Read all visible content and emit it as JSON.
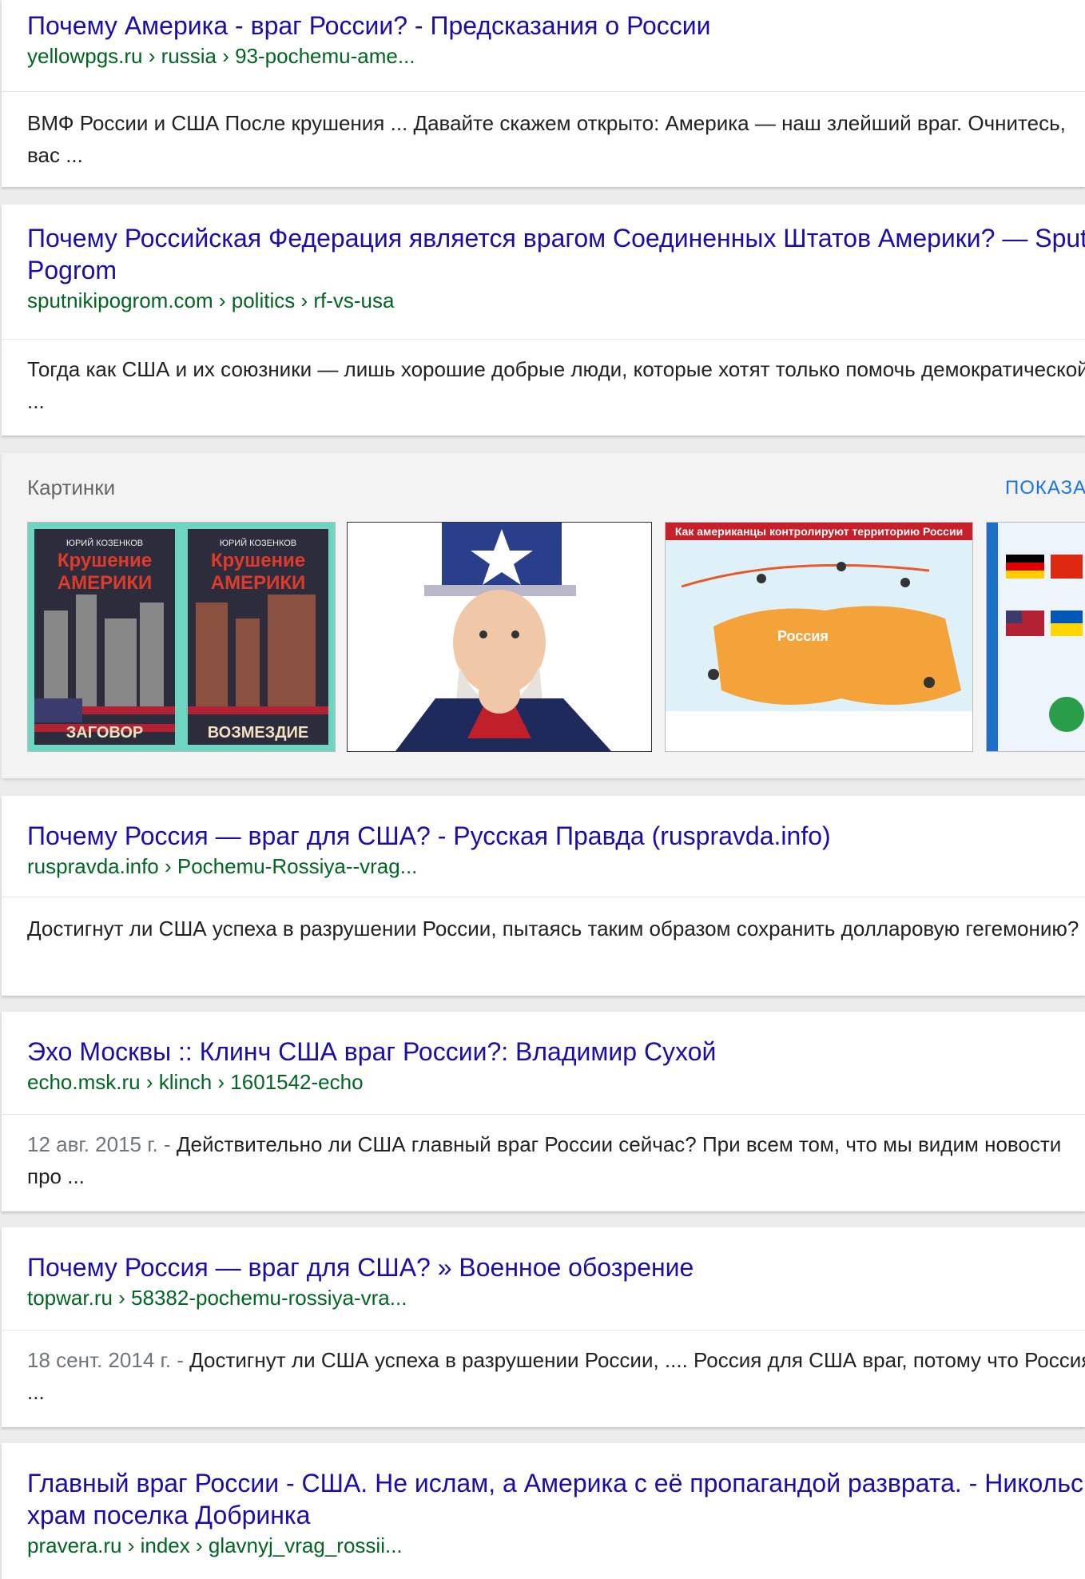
{
  "results": [
    {
      "title": "Почему Америка - враг России? - Предсказания о России",
      "url": "yellowpgs.ru › russia › 93-pochemu-ame...",
      "snippet": "ВМФ России и США После крушения ... Давайте скажем открыто: Америка — наш злейший враг. Очнитесь, вас ..."
    },
    {
      "title": "Почему Российская Федерация является врагом Соединенных Штатов Америки? — Sputnik & Pogrom",
      "url": "sputnikipogrom.com › politics › rf-vs-usa",
      "snippet": "Тогда как США и их союзники — лишь хорошие добрые люди, которые хотят только помочь демократической ..."
    },
    {
      "title": "Почему Россия — враг для США? - Русская Правда (ruspravda.info)",
      "url": "ruspravda.info › Pochemu-Rossiya--vrag...",
      "snippet": "Достигнут ли США успеха в разрушении России, пытаясь таким образом сохранить долларовую гегемонию?"
    },
    {
      "title": "Эхо Москвы :: Клинч США враг России?: Владимир Сухой",
      "url": "echo.msk.ru › klinch › 1601542-echo",
      "date": "12 авг. 2015 г. - ",
      "snippet": "Действительно ли США главный враг России сейчас? При всем том, что мы видим новости про ..."
    },
    {
      "title": "Почему Россия — враг для США? » Военное обозрение",
      "url": "topwar.ru › 58382-pochemu-rossiya-vra...",
      "date": "18 сент. 2014 г. - ",
      "snippet": "Достигнут ли США успеха в разрушении России, .... Россия для США враг, потому что Россия ..."
    },
    {
      "title": "Главный враг России - США. Не ислам, а Америка с её пропагандой разврата. - Никольский храм поселка Добринка",
      "url": "pravera.ru › index › glavnyj_vrag_rossii..."
    }
  ],
  "images": {
    "label": "Картинки",
    "more": "ПОКАЗАТЬ ВСЕ",
    "thumbs": [
      {
        "name": "book-covers",
        "book1": {
          "author": "ЮРИЙ КОЗЕНКОВ",
          "title1": "Крушение",
          "title2": "АМЕРИКИ",
          "subtitle": "ЗАГОВОР"
        },
        "book2": {
          "author": "ЮРИЙ КОЗЕНКОВ",
          "title1": "Крушение",
          "title2": "АМЕРИКИ",
          "subtitle": "ВОЗМЕЗДИЕ"
        }
      },
      {
        "name": "uncle-sam"
      },
      {
        "name": "map",
        "header": "Как американцы контролируют территорию России",
        "region": "Россия"
      },
      {
        "name": "flags-infographic"
      }
    ]
  },
  "colors": {
    "title": "#1a0dab",
    "url": "#006621",
    "snippet": "#222222",
    "more": "#1a73e8"
  }
}
